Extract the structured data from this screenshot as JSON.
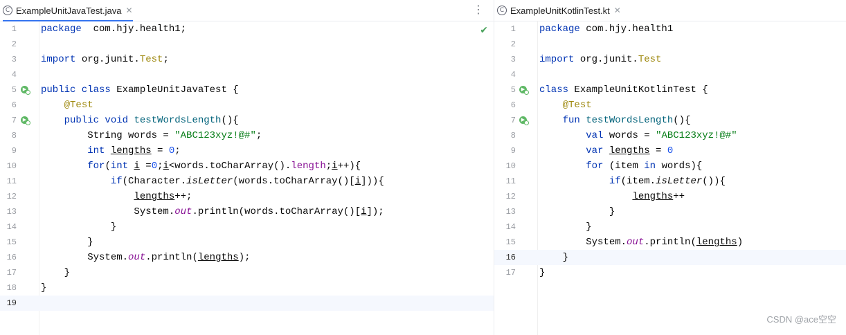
{
  "left": {
    "tab_label": "ExampleUnitJavaTest.java",
    "tab_icon": "java-class-icon",
    "tab_icon_glyph": "C",
    "close_glyph": "✕",
    "menu_glyph": "⋮",
    "status_glyph": "✔",
    "line_numbers": [
      "1",
      "2",
      "3",
      "4",
      "5",
      "6",
      "7",
      "8",
      "9",
      "10",
      "11",
      "12",
      "13",
      "14",
      "15",
      "16",
      "17",
      "18",
      "19"
    ],
    "current_line": 19,
    "run_icon_lines": [
      5,
      7
    ]
  },
  "right": {
    "tab_label": "ExampleUnitKotlinTest.kt",
    "tab_icon": "kotlin-class-icon",
    "tab_icon_glyph": "C",
    "close_glyph": "✕",
    "line_numbers": [
      "1",
      "2",
      "3",
      "4",
      "5",
      "6",
      "7",
      "8",
      "9",
      "10",
      "11",
      "12",
      "13",
      "14",
      "15",
      "16",
      "17"
    ],
    "current_line": 16,
    "run_icon_lines": [
      5,
      7
    ]
  },
  "watermark": "CSDN @ace空空",
  "colors": {
    "keyword": "#0033b3",
    "annotation": "#9e880d",
    "string": "#067d17",
    "number": "#1750eb",
    "method": "#00627a",
    "field": "#871094",
    "tab_underline": "#3574f0"
  }
}
